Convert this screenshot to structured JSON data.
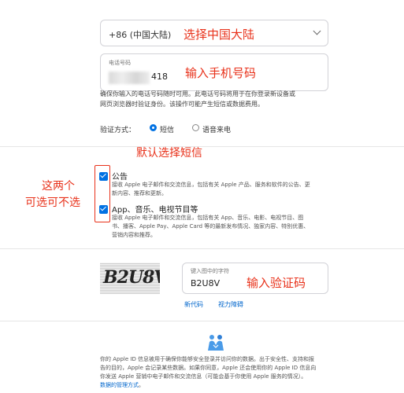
{
  "country_select": {
    "value": "+86 (中国大陆)"
  },
  "phone": {
    "label": "电话号码",
    "value_suffix": "418"
  },
  "phone_description": [
    "确保你输入的电话号码随时可用。此电话号码将用于在你登录新设备或",
    "网页浏览器时验证身份。该操作可能产生短信或数据费用。"
  ],
  "verify_method": {
    "label": "验证方式：",
    "options": [
      {
        "label": "短信",
        "selected": true
      },
      {
        "label": "语音来电",
        "selected": false
      }
    ]
  },
  "checkboxes": [
    {
      "title": "公告",
      "checked": true,
      "lines": [
        "接收 Apple 电子邮件和交流信息，包括有关 Apple 产品、服务和软件的公告、更",
        "新内容、推荐和更新。"
      ]
    },
    {
      "title": "App、音乐、电视节目等",
      "checked": true,
      "lines": [
        "接收 Apple 电子邮件和交流信息，包括有关 App、音乐、电影、电视节目、图",
        "书、播客、Apple Pay、Apple Card 等的最新发布情况、独家内容、特别优惠、",
        "营销内容和推荐。"
      ]
    }
  ],
  "captcha": {
    "image_text": "B2U8V",
    "field_label": "键入图中的字符",
    "field_value": "B2U8V",
    "new_code_link": "新代码",
    "accessibility_link": "视力障碍"
  },
  "footer": {
    "lines": [
      "你的 Apple ID 信息被用于确保你能够安全登录并访问你的数据。出于安全性、支持和报",
      "告的目的，Apple 会记录某些数据。如果你同意，Apple 还会使用你的 Apple ID 信息向",
      "你发送 Apple 营销中电子邮件和交流信息（可能会基于你使用 Apple 服务的情况）。"
    ],
    "last_prefix": "",
    "link": "数据的管理方式",
    "last_suffix": "。"
  },
  "annotations": {
    "country": "选择中国大陆",
    "phone": "输入手机号码",
    "sms": "默认选择短信",
    "optional_line1": "这两个",
    "optional_line2": "可选可不选",
    "captcha": "输入验证码"
  },
  "colors": {
    "accent": "#0071e3",
    "annotation": "#e8311a",
    "link": "#0066cc"
  }
}
